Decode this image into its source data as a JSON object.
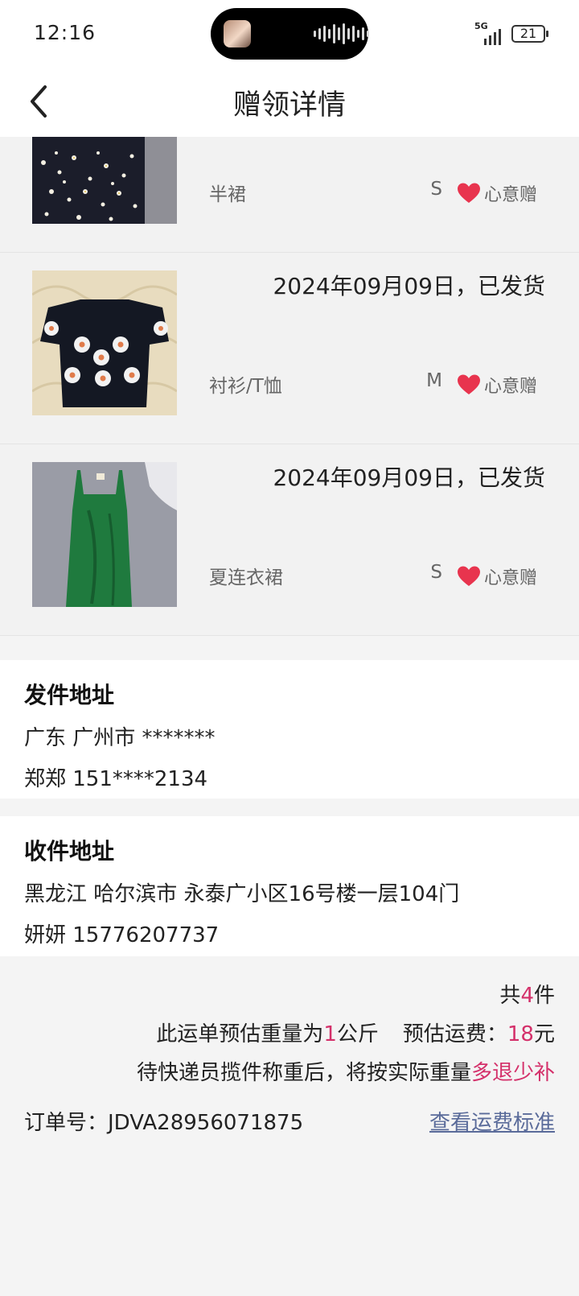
{
  "status_bar": {
    "time": "12:16",
    "network": "5G",
    "battery": "21",
    "island_avatar_icon": "thumbnail",
    "island_wave_icon": "audio-waveform-icon"
  },
  "header": {
    "back_icon": "chevron-left-icon",
    "title": "赠领详情"
  },
  "items": [
    {
      "image": "photo of dark floral skirt",
      "category": "半裙",
      "size": "S",
      "gift_label": "心意赠"
    },
    {
      "image": "photo of black top with flower appliqués",
      "date_status": "2024年09月09日，已发货",
      "category": "衬衫/T恤",
      "size": "M",
      "gift_label": "心意赠"
    },
    {
      "image": "photo of green dress",
      "date_status": "2024年09月09日，已发货",
      "category": "夏连衣裙",
      "size": "S",
      "gift_label": "心意赠"
    }
  ],
  "sender": {
    "heading": "发件地址",
    "address": "广东 广州市 *******",
    "contact": "郑郑 151****2134"
  },
  "receiver": {
    "heading": "收件地址",
    "address": "黑龙江 哈尔滨市 永泰广小区16号楼一层104门",
    "contact": "妍妍 15776207737"
  },
  "summary": {
    "total_prefix": "共",
    "total_count": "4",
    "total_suffix": "件",
    "weight_prefix": "此运单预估重量为",
    "weight_value": "1",
    "weight_unit": "公斤",
    "fee_label": "预估运费：",
    "fee_value": "18",
    "fee_unit": "元",
    "note_prefix": "待快递员揽件称重后，将按实际重量",
    "note_highlight": "多退少补"
  },
  "order": {
    "label": "订单号：",
    "number": "JDVA28956071875",
    "fee_standard_link": "查看运费标准"
  },
  "colors": {
    "accent_red": "#d4306a",
    "heart": "#e8344e",
    "link": "#5a6b9a",
    "background": "#f4f4f4"
  }
}
